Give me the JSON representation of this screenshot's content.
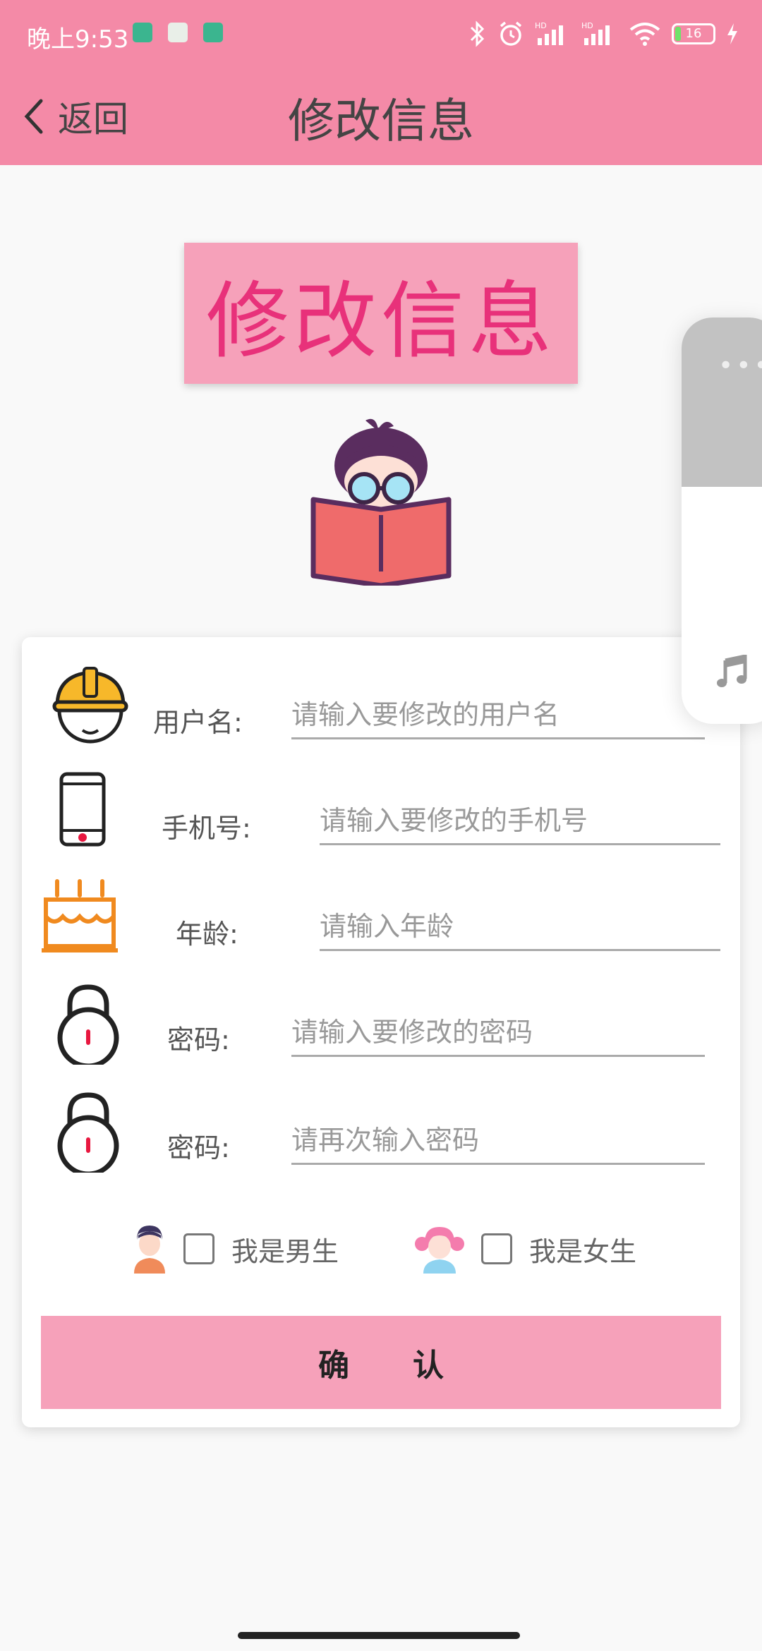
{
  "status_bar": {
    "time": "晚上9:53",
    "battery": "16",
    "icons": [
      "bluetooth-icon",
      "alarm-icon",
      "hd-signal-icon",
      "hd-signal-icon",
      "wifi-icon",
      "battery-icon",
      "charging-icon"
    ]
  },
  "header": {
    "back_label": "返回",
    "title": "修改信息"
  },
  "banner": {
    "text": "修改信息"
  },
  "form": {
    "username": {
      "label": "用户名:",
      "placeholder": "请输入要修改的用户名",
      "icon": "helmet-icon"
    },
    "phone": {
      "label": "手机号:",
      "placeholder": "请输入要修改的手机号",
      "icon": "phone-icon"
    },
    "age": {
      "label": "年龄:",
      "placeholder": "请输入年龄",
      "icon": "cake-icon"
    },
    "password": {
      "label": "密码:",
      "placeholder": "请输入要修改的密码",
      "icon": "lock-icon"
    },
    "password_confirm": {
      "label": "密码:",
      "placeholder": "请再次输入密码",
      "icon": "lock-icon"
    },
    "gender": {
      "male_label": "我是男生",
      "female_label": "我是女生"
    },
    "confirm_label": "确认"
  },
  "colors": {
    "header": "#f48aa7",
    "banner_bg": "#f6a1ba",
    "banner_text": "#e8317a",
    "confirm_bg": "#f6a1ba",
    "background": "#f9f9f9"
  }
}
